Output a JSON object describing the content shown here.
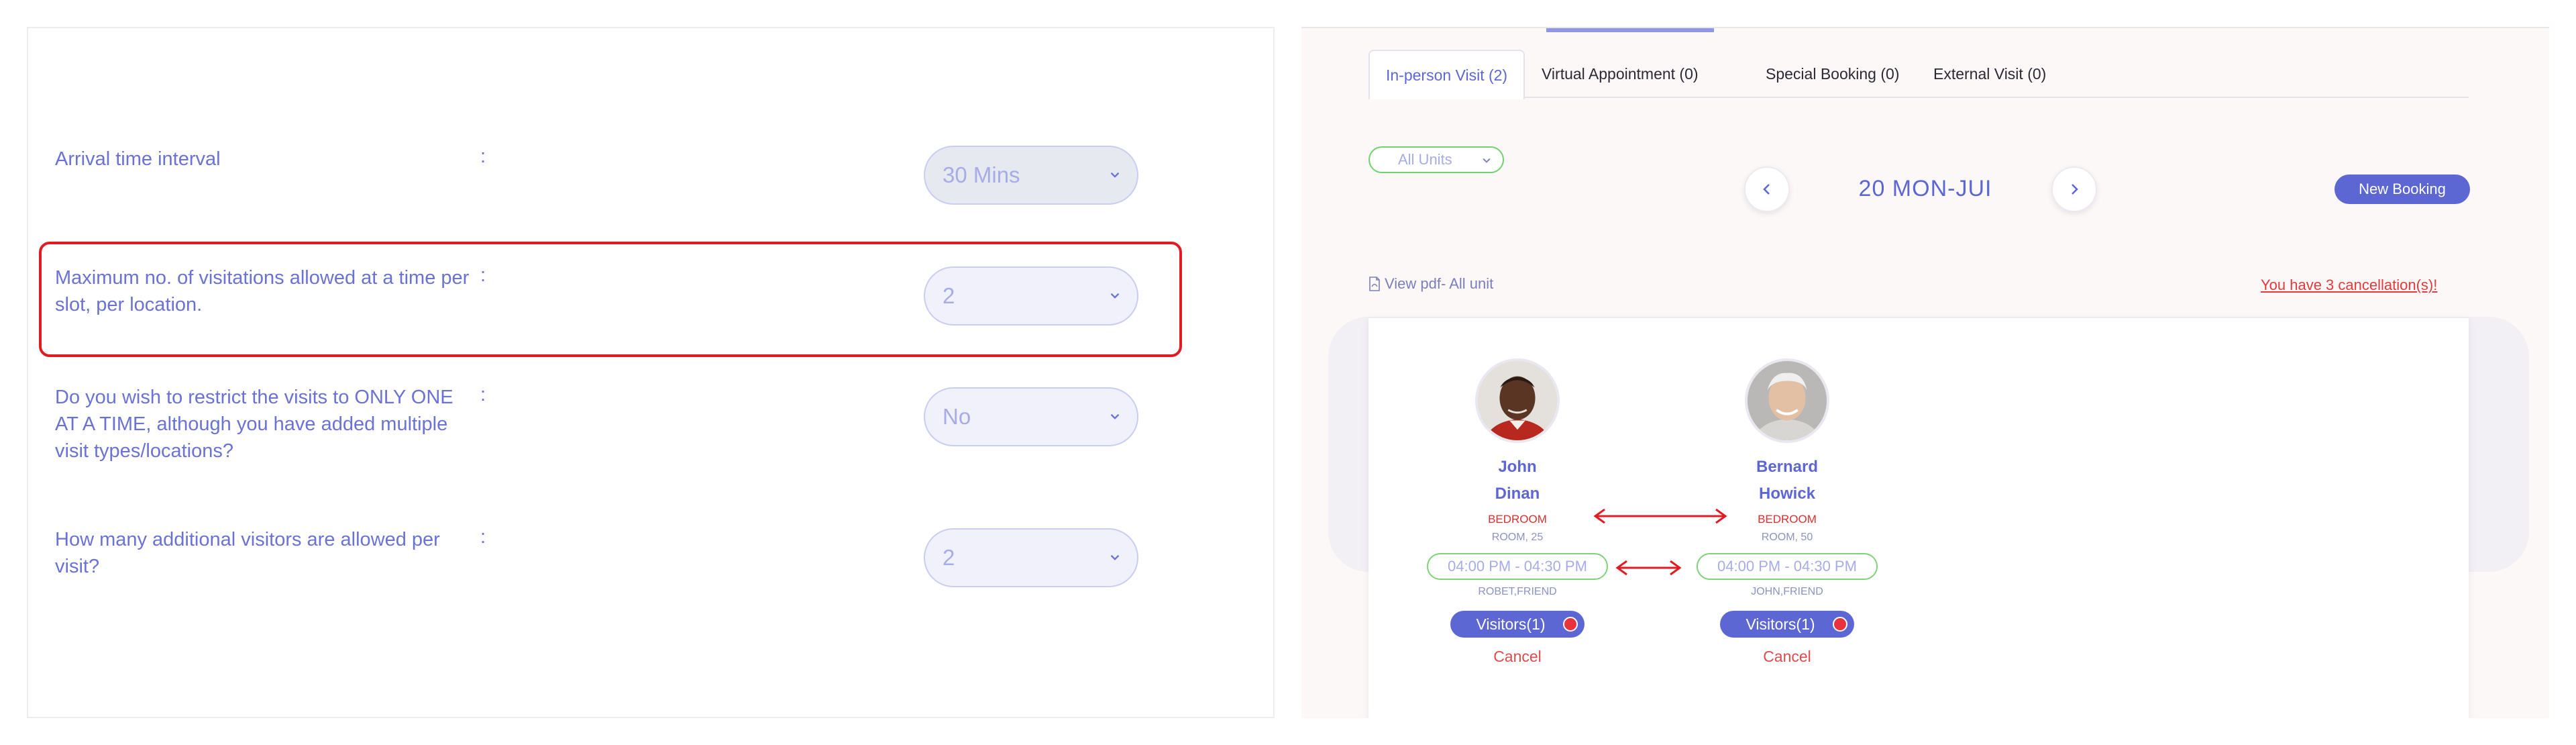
{
  "settings": {
    "rows": [
      {
        "label": "Arrival time interval",
        "value": "30 Mins"
      },
      {
        "label": "Maximum no. of visitations allowed at a time per slot, per location.",
        "value": "2"
      },
      {
        "label": "Do you wish to restrict the visits to ONLY ONE AT A TIME, although you have added multiple visit types/locations?",
        "value": "No"
      },
      {
        "label": "How many additional visitors are allowed per visit?",
        "value": "2"
      }
    ],
    "colon": ":"
  },
  "booking": {
    "tabs": [
      {
        "label": "In-person Visit (2)"
      },
      {
        "label": "Virtual Appointment (0)"
      },
      {
        "label": "Special Booking (0)"
      },
      {
        "label": "External Visit (0)"
      }
    ],
    "units_filter": "All Units",
    "date": "20 MON-JUI",
    "new_booking": "New Booking",
    "view_pdf": "View pdf- All unit",
    "cancel_notice": "You have 3 cancellation(s)!",
    "residents": [
      {
        "first_name": "John",
        "last_name": "Dinan",
        "room_type": "BEDROOM",
        "room_no": "ROOM, 25",
        "time": "04:00 PM - 04:30 PM",
        "visitor": "ROBET,FRIEND",
        "visitors_label": "Visitors(1)",
        "cancel": "Cancel"
      },
      {
        "first_name": "Bernard",
        "last_name": "Howick",
        "room_type": "BEDROOM",
        "room_no": "ROOM, 50",
        "time": "04:00 PM - 04:30 PM",
        "visitor": "JOHN,FRIEND",
        "visitors_label": "Visitors(1)",
        "cancel": "Cancel"
      }
    ]
  },
  "colors": {
    "accent": "#5d67d4",
    "highlight": "#e11b22",
    "green": "#7ed376",
    "danger": "#e33a3a"
  },
  "icons": [
    "chevron-down-icon",
    "chevron-left-icon",
    "chevron-right-icon",
    "pdf-icon",
    "double-arrow-icon"
  ]
}
